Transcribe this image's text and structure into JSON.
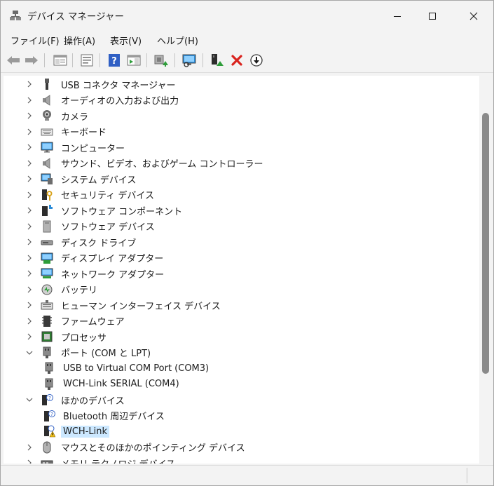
{
  "window": {
    "title": "デバイス マネージャー"
  },
  "menu": [
    "ファイル(F)",
    "操作(A)",
    "表示(V)",
    "ヘルプ(H)"
  ],
  "toolbar": {
    "buttons": [
      "back-icon",
      "forward-icon",
      "properties-pane-icon",
      "device-list-icon",
      "help-icon",
      "action-pane-icon",
      "update-driver-icon",
      "scan-hardware-icon",
      "enable-device-icon",
      "uninstall-icon",
      "download-icon"
    ]
  },
  "tree": {
    "rows": [
      {
        "label": "USB コネクタ マネージャー",
        "icon": "usb-connector-icon",
        "expander": "collapsed"
      },
      {
        "label": "オーディオの入力および出力",
        "icon": "speaker-icon",
        "expander": "collapsed"
      },
      {
        "label": "カメラ",
        "icon": "camera-icon",
        "expander": "collapsed"
      },
      {
        "label": "キーボード",
        "icon": "keyboard-icon",
        "expander": "collapsed"
      },
      {
        "label": "コンピューター",
        "icon": "monitor-icon",
        "expander": "collapsed"
      },
      {
        "label": "サウンド、ビデオ、およびゲーム コントローラー",
        "icon": "speaker-icon",
        "expander": "collapsed"
      },
      {
        "label": "システム デバイス",
        "icon": "system-device-icon",
        "expander": "collapsed"
      },
      {
        "label": "セキュリティ デバイス",
        "icon": "security-key-icon",
        "expander": "collapsed"
      },
      {
        "label": "ソフトウェア コンポーネント",
        "icon": "software-component-icon",
        "expander": "collapsed"
      },
      {
        "label": "ソフトウェア デバイス",
        "icon": "software-device-icon",
        "expander": "collapsed"
      },
      {
        "label": "ディスク ドライブ",
        "icon": "disk-drive-icon",
        "expander": "collapsed"
      },
      {
        "label": "ディスプレイ アダプター",
        "icon": "display-adapter-icon",
        "expander": "collapsed"
      },
      {
        "label": "ネットワーク アダプター",
        "icon": "network-adapter-icon",
        "expander": "collapsed"
      },
      {
        "label": "バッテリ",
        "icon": "battery-icon",
        "expander": "collapsed"
      },
      {
        "label": "ヒューマン インターフェイス デバイス",
        "icon": "hid-icon",
        "expander": "collapsed"
      },
      {
        "label": "ファームウェア",
        "icon": "firmware-icon",
        "expander": "collapsed"
      },
      {
        "label": "プロセッサ",
        "icon": "processor-icon",
        "expander": "collapsed"
      },
      {
        "label": "ポート (COM と LPT)",
        "icon": "port-icon",
        "expander": "expanded"
      },
      {
        "label": "USB to Virtual COM Port (COM3)",
        "icon": "port-icon",
        "expander": "none",
        "child": true
      },
      {
        "label": "WCH-Link SERIAL (COM4)",
        "icon": "port-icon",
        "expander": "none",
        "child": true
      },
      {
        "label": "ほかのデバイス",
        "icon": "unknown-device-icon",
        "expander": "expanded"
      },
      {
        "label": "Bluetooth 周辺デバイス",
        "icon": "unknown-device-icon",
        "expander": "none",
        "child": true
      },
      {
        "label": "WCH-Link",
        "icon": "warning-device-icon",
        "expander": "none",
        "child": true,
        "selected": true
      },
      {
        "label": "マウスとそのほかのポインティング デバイス",
        "icon": "mouse-icon",
        "expander": "collapsed"
      },
      {
        "label": "メモリ テクノロジ デバイス",
        "icon": "memory-device-icon",
        "expander": "collapsed"
      }
    ]
  },
  "colors": {
    "selection": "#cce8ff",
    "accent_green": "#2e9d3a",
    "accent_red": "#d9231e",
    "help_blue": "#2f5fc4"
  }
}
